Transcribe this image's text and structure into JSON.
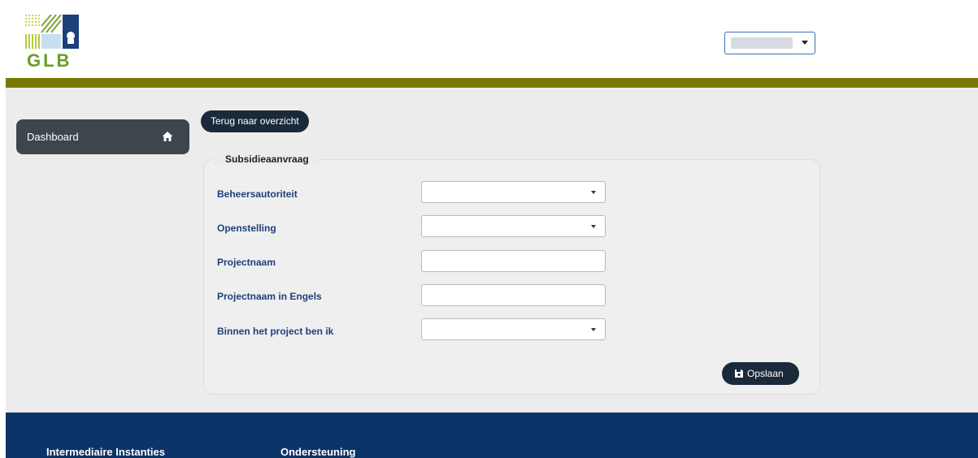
{
  "header": {
    "logo_text": "GLB",
    "user_select_value": ""
  },
  "sidebar": {
    "items": [
      {
        "label": "Dashboard",
        "icon": "home-icon"
      }
    ]
  },
  "main": {
    "back_button_label": "Terug naar overzicht",
    "form": {
      "legend": "Subsidieaanvraag",
      "fields": [
        {
          "label": "Beheersautoriteit",
          "type": "select",
          "value": ""
        },
        {
          "label": "Openstelling",
          "type": "select",
          "value": ""
        },
        {
          "label": "Projectnaam",
          "type": "text",
          "value": ""
        },
        {
          "label": "Projectnaam in Engels",
          "type": "text",
          "value": ""
        },
        {
          "label": "Binnen het project ben ik",
          "type": "select",
          "value": ""
        }
      ],
      "save_label": "Opslaan",
      "save_icon": "floppy-disk-icon"
    }
  },
  "footer": {
    "columns": [
      "Intermediaire Instanties",
      "Ondersteuning"
    ]
  },
  "colors": {
    "olive": "#7a7800",
    "dark_button": "#1b2a3b",
    "sidebar": "#3d464d",
    "footer": "#0c3468",
    "label_blue": "#1f3f7a"
  }
}
